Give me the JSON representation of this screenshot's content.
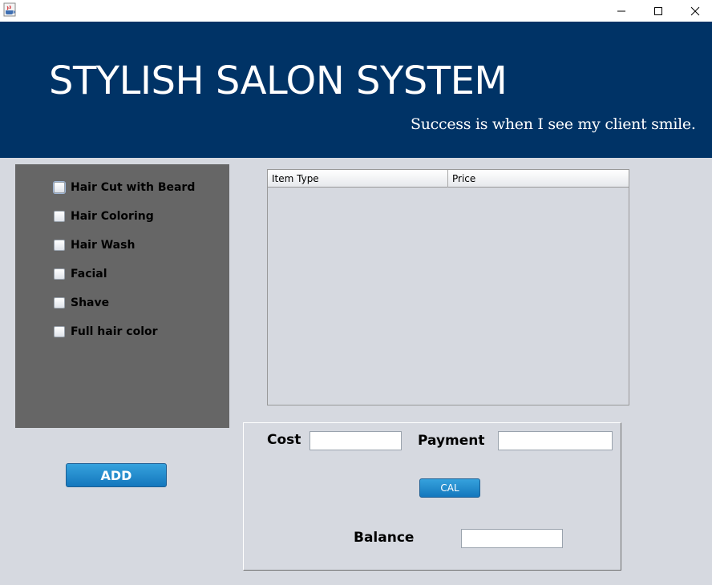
{
  "window": {
    "app_icon": "java-coffee-icon",
    "controls": [
      {
        "name": "minimize",
        "glyph": "—"
      },
      {
        "name": "maximize",
        "glyph": "☐"
      },
      {
        "name": "close",
        "glyph": "✕"
      }
    ]
  },
  "header": {
    "title": "STYLISH SALON SYSTEM",
    "tagline": "Success is when I see my client smile.",
    "background": "#003366"
  },
  "services": {
    "items": [
      {
        "label": "Hair Cut with Beard",
        "checked": false
      },
      {
        "label": "Hair Coloring",
        "checked": false
      },
      {
        "label": "Hair Wash",
        "checked": false
      },
      {
        "label": "Facial",
        "checked": false
      },
      {
        "label": "Shave",
        "checked": false
      },
      {
        "label": "Full hair color",
        "checked": false
      }
    ],
    "panel_color": "#666666"
  },
  "actions": {
    "add_label": "ADD",
    "button_color": "#1f86c9"
  },
  "table": {
    "columns": [
      "Item Type",
      "Price"
    ],
    "rows": []
  },
  "payment": {
    "cost_label": "Cost",
    "cost_value": "",
    "payment_label": "Payment",
    "payment_value": "",
    "cal_label": "CAL",
    "balance_label": "Balance",
    "balance_value": ""
  }
}
